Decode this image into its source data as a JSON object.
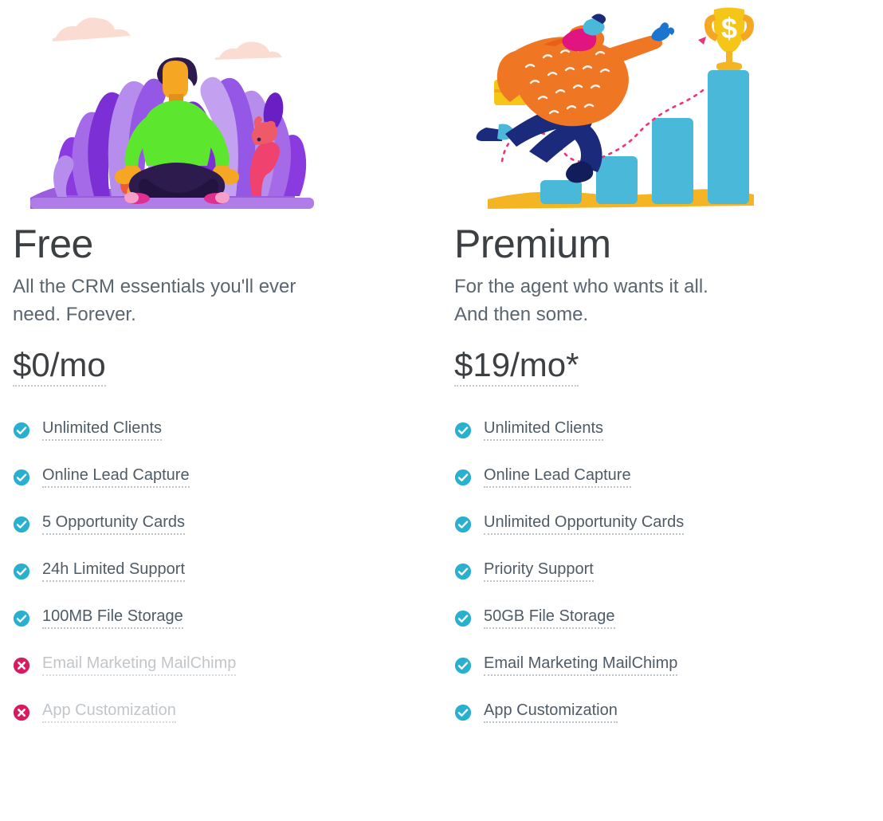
{
  "theme": {
    "check_color": "#29b0d0",
    "cross_color": "#d81b60",
    "heading_color": "#3c4043",
    "body_color": "#5a6570",
    "feature_color": "#4f5b66",
    "disabled_color": "#c2c6ca",
    "background": "#ffffff"
  },
  "plans": [
    {
      "illustration_name": "meditating-person-illustration",
      "name": "Free",
      "tagline": "All the CRM essentials you'll ever need. Forever.",
      "price": "$0/mo",
      "features": [
        {
          "label": "Unlimited Clients",
          "icon": "check-circle-icon",
          "included": true
        },
        {
          "label": "Online Lead Capture",
          "icon": "check-circle-icon",
          "included": true
        },
        {
          "label": "5 Opportunity Cards",
          "icon": "check-circle-icon",
          "included": true
        },
        {
          "label": "24h Limited Support",
          "icon": "check-circle-icon",
          "included": true
        },
        {
          "label": "100MB File Storage",
          "icon": "check-circle-icon",
          "included": true
        },
        {
          "label": "Email Marketing MailChimp",
          "icon": "cross-circle-icon",
          "included": false
        },
        {
          "label": "App Customization",
          "icon": "cross-circle-icon",
          "included": false
        }
      ]
    },
    {
      "illustration_name": "businessman-climbing-chart-illustration",
      "name": "Premium",
      "tagline": "For the agent who wants it all. And then some.",
      "price": "$19/mo*",
      "features": [
        {
          "label": "Unlimited Clients",
          "icon": "check-circle-icon",
          "included": true
        },
        {
          "label": "Online Lead Capture",
          "icon": "check-circle-icon",
          "included": true
        },
        {
          "label": "Unlimited Opportunity Cards",
          "icon": "check-circle-icon",
          "included": true
        },
        {
          "label": "Priority Support",
          "icon": "check-circle-icon",
          "included": true
        },
        {
          "label": "50GB File Storage",
          "icon": "check-circle-icon",
          "included": true
        },
        {
          "label": "Email Marketing MailChimp",
          "icon": "check-circle-icon",
          "included": true
        },
        {
          "label": "App Customization",
          "icon": "check-circle-icon",
          "included": true
        }
      ]
    }
  ]
}
